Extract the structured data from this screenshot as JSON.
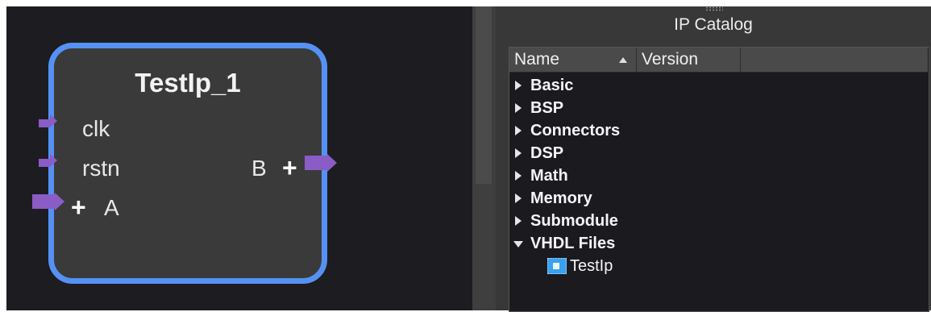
{
  "canvas": {
    "block": {
      "title": "TestIp_1",
      "inputs": [
        {
          "name": "clk",
          "bus": false
        },
        {
          "name": "rstn",
          "bus": false
        },
        {
          "name": "A",
          "bus": true
        }
      ],
      "outputs": [
        {
          "name": "B",
          "bus": true
        }
      ],
      "plus_symbol": "+",
      "colors": {
        "border": "#5591f3",
        "pin": "#8a5cc6",
        "body": "#3a3a3a"
      }
    }
  },
  "ip_catalog": {
    "title": "IP Catalog",
    "columns": {
      "name": "Name",
      "version": "Version"
    },
    "sort": {
      "column": "Name",
      "direction": "ascending"
    },
    "categories": [
      {
        "label": "Basic",
        "expanded": false
      },
      {
        "label": "BSP",
        "expanded": false
      },
      {
        "label": "Connectors",
        "expanded": false
      },
      {
        "label": "DSP",
        "expanded": false
      },
      {
        "label": "Math",
        "expanded": false
      },
      {
        "label": "Memory",
        "expanded": false
      },
      {
        "label": "Submodule",
        "expanded": false
      },
      {
        "label": "VHDL Files",
        "expanded": true,
        "children": [
          {
            "label": "TestIp",
            "icon": "ip-core-icon"
          }
        ]
      }
    ]
  }
}
